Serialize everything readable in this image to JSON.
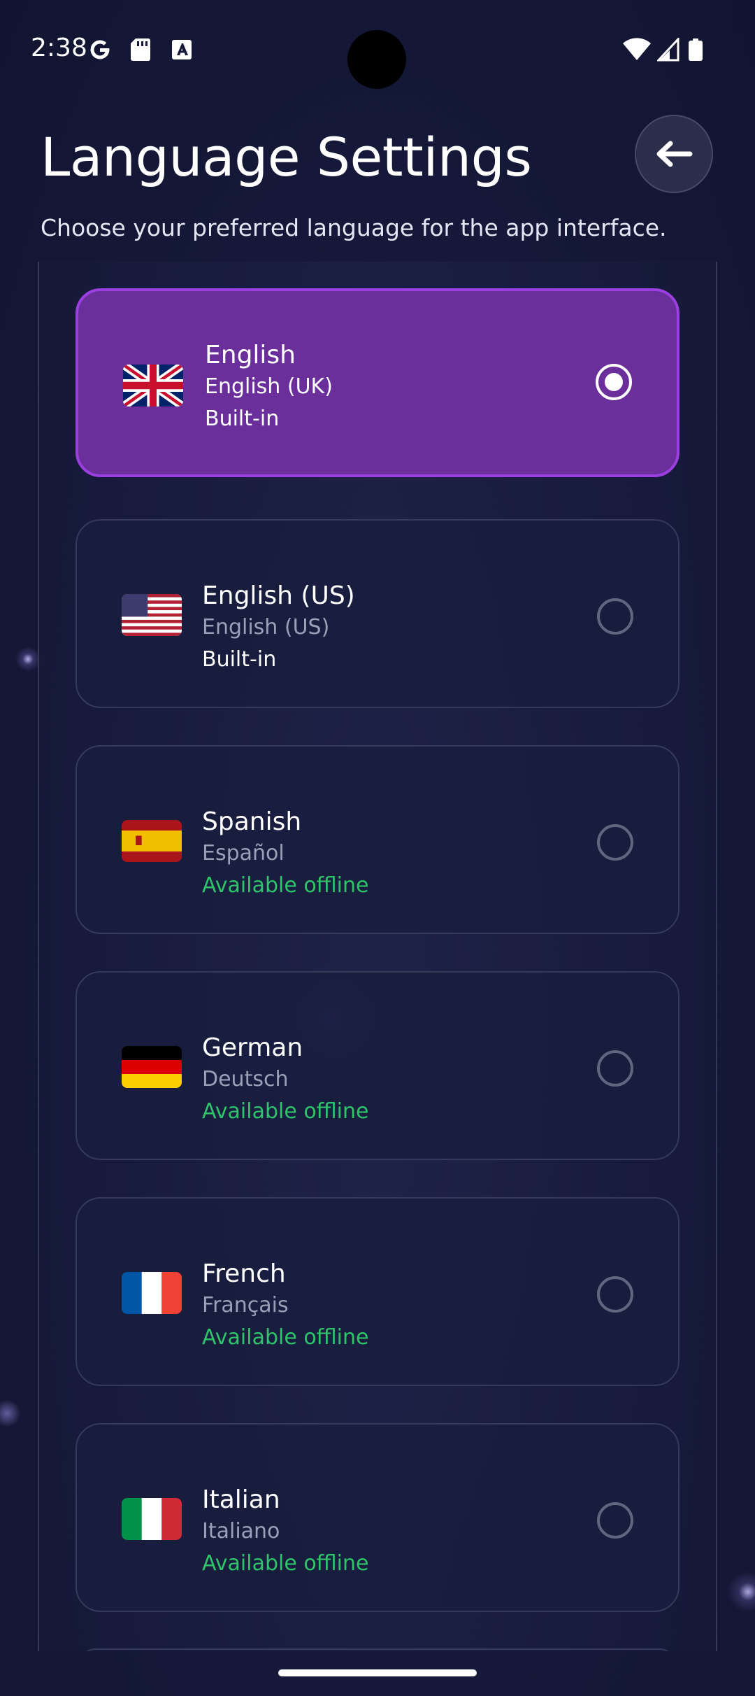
{
  "status_bar": {
    "time": "2:38",
    "left_icons": [
      "google-icon",
      "sd-card-icon",
      "font-download-icon"
    ],
    "right_icons": [
      "wifi-icon",
      "cell-signal-icon",
      "battery-icon"
    ]
  },
  "header": {
    "title": "Language Settings",
    "subtitle": "Choose your preferred language for the app interface.",
    "back_icon": "arrow-left-icon"
  },
  "languages": [
    {
      "name": "English",
      "native": "English (UK)",
      "status": "Built-in",
      "flag": "uk-flag",
      "selected": true
    },
    {
      "name": "English (US)",
      "native": "English (US)",
      "status": "Built-in",
      "flag": "us-flag",
      "selected": false
    },
    {
      "name": "Spanish",
      "native": "Español",
      "status": "Available offline",
      "flag": "spain-flag",
      "selected": false
    },
    {
      "name": "German",
      "native": "Deutsch",
      "status": "Available offline",
      "flag": "germany-flag",
      "selected": false
    },
    {
      "name": "French",
      "native": "Français",
      "status": "Available offline",
      "flag": "france-flag",
      "selected": false
    },
    {
      "name": "Italian",
      "native": "Italiano",
      "status": "Available offline",
      "flag": "italy-flag",
      "selected": false
    }
  ],
  "colors": {
    "background": "#16193a",
    "selected_card": "#6a2f9b",
    "selected_border": "#9b3fe0",
    "offline_green": "#2fc46a"
  }
}
